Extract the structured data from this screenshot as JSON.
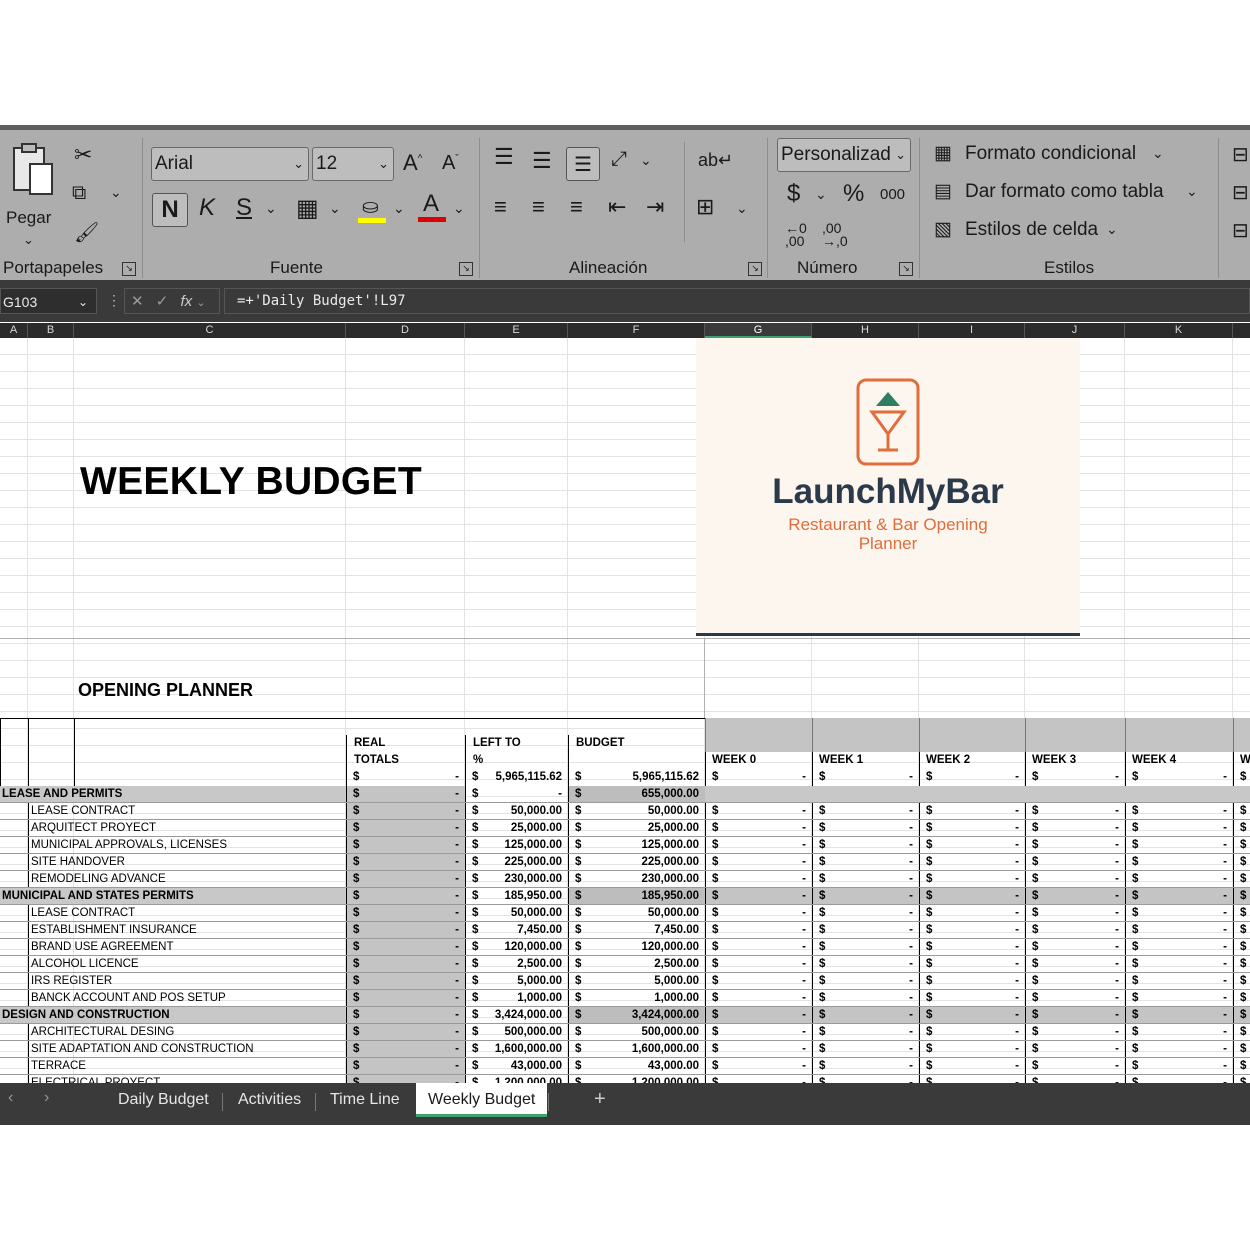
{
  "ribbon": {
    "clipboard": {
      "paste_label": "Pegar",
      "group_label": "Portapapeles"
    },
    "font": {
      "family": "Arial",
      "size": "12",
      "bold": "N",
      "italic": "K",
      "underline": "S",
      "group_label": "Fuente"
    },
    "alignment": {
      "group_label": "Alineación"
    },
    "number": {
      "format": "Personalizad",
      "currency": "$",
      "percent": "%",
      "thousands": "000",
      "dec_dec": "←0\n,00",
      "dec_inc": ",00\n→,0",
      "group_label": "Número"
    },
    "styles": {
      "conditional": "Formato condicional",
      "as_table": "Dar formato como tabla",
      "cell_styles": "Estilos de celda",
      "group_label": "Estilos"
    }
  },
  "formula_bar": {
    "name_box": "G103",
    "formula": "=+'Daily Budget'!L97"
  },
  "columns": [
    "A",
    "B",
    "C",
    "D",
    "E",
    "F",
    "G",
    "H",
    "I",
    "J",
    "K"
  ],
  "sheet": {
    "title": "WEEKLY BUDGET",
    "subtitle": "OPENING PLANNER",
    "logo": {
      "name": "LaunchMyBar",
      "tagline1": "Restaurant & Bar Opening",
      "tagline2": "Planner"
    },
    "headers": {
      "real": "REAL",
      "totals": "TOTALS",
      "left_to": "LEFT TO",
      "pct": "%",
      "budget": "BUDGET"
    },
    "weeks": [
      "WEEK 0",
      "WEEK 1",
      "WEEK 2",
      "WEEK 3",
      "WEEK 4",
      "W"
    ],
    "currency": "$",
    "dash": "-",
    "totals_row": {
      "real": "-",
      "left": "5,965,115.62",
      "budget": "5,965,115.62"
    },
    "rows": [
      {
        "label": "LEASE AND PERMITS",
        "cat": true,
        "left": "-",
        "budget": "655,000.00",
        "weeks": false
      },
      {
        "label": "LEASE CONTRACT",
        "cat": false,
        "left": "50,000.00",
        "budget": "50,000.00",
        "weeks": true
      },
      {
        "label": "ARQUITECT PROYECT",
        "cat": false,
        "left": "25,000.00",
        "budget": "25,000.00",
        "weeks": true
      },
      {
        "label": "MUNICIPAL APPROVALS, LICENSES",
        "cat": false,
        "left": "125,000.00",
        "budget": "125,000.00",
        "weeks": true
      },
      {
        "label": "SITE HANDOVER",
        "cat": false,
        "left": "225,000.00",
        "budget": "225,000.00",
        "weeks": true
      },
      {
        "label": "REMODELING ADVANCE",
        "cat": false,
        "left": "230,000.00",
        "budget": "230,000.00",
        "weeks": true
      },
      {
        "label": "MUNICIPAL AND STATES PERMITS",
        "cat": true,
        "left": "185,950.00",
        "budget": "185,950.00",
        "weeks": true
      },
      {
        "label": "LEASE CONTRACT",
        "cat": false,
        "left": "50,000.00",
        "budget": "50,000.00",
        "weeks": true
      },
      {
        "label": "ESTABLISHMENT INSURANCE",
        "cat": false,
        "left": "7,450.00",
        "budget": "7,450.00",
        "weeks": true
      },
      {
        "label": "BRAND USE AGREEMENT",
        "cat": false,
        "left": "120,000.00",
        "budget": "120,000.00",
        "weeks": true
      },
      {
        "label": "ALCOHOL LICENCE",
        "cat": false,
        "left": "2,500.00",
        "budget": "2,500.00",
        "weeks": true
      },
      {
        "label": "IRS REGISTER",
        "cat": false,
        "left": "5,000.00",
        "budget": "5,000.00",
        "weeks": true
      },
      {
        "label": "BANCK ACCOUNT AND POS SETUP",
        "cat": false,
        "left": "1,000.00",
        "budget": "1,000.00",
        "weeks": true
      },
      {
        "label": "DESIGN AND CONSTRUCTION",
        "cat": true,
        "left": "3,424,000.00",
        "budget": "3,424,000.00",
        "weeks": true
      },
      {
        "label": "ARCHITECTURAL DESING",
        "cat": false,
        "left": "500,000.00",
        "budget": "500,000.00",
        "weeks": true
      },
      {
        "label": "SITE ADAPTATION AND CONSTRUCTION",
        "cat": false,
        "left": "1,600,000.00",
        "budget": "1,600,000.00",
        "weeks": true
      },
      {
        "label": "TERRACE",
        "cat": false,
        "left": "43,000.00",
        "budget": "43,000.00",
        "weeks": true
      },
      {
        "label": "ELECTRICAL PROYECT",
        "cat": false,
        "left": "1,200,000.00",
        "budget": "1,200,000.00",
        "weeks": true
      }
    ]
  },
  "tabs": {
    "items": [
      "Daily Budget",
      "Activities",
      "Time Line",
      "Weekly Budget"
    ],
    "active": "Weekly Budget",
    "add": "+"
  }
}
